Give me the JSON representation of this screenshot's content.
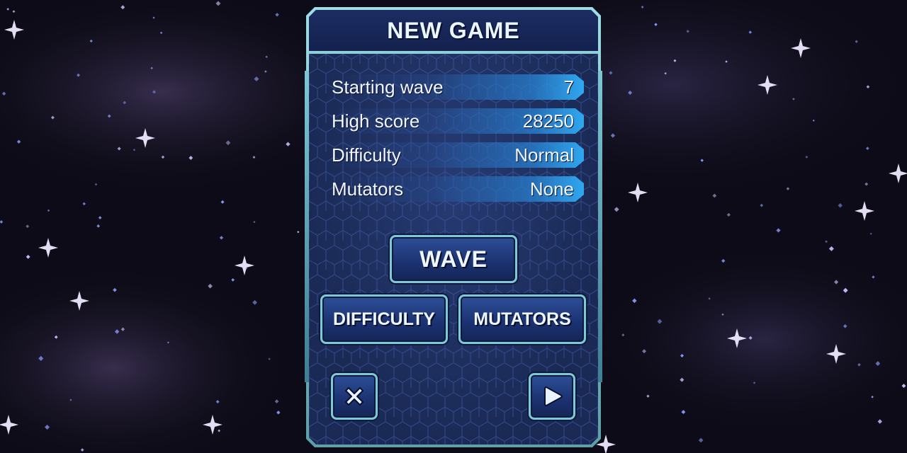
{
  "dialog": {
    "title": "NEW GAME"
  },
  "stats": [
    {
      "label": "Starting wave",
      "value": "7"
    },
    {
      "label": "High score",
      "value": "28250"
    },
    {
      "label": "Difficulty",
      "value": "Normal"
    },
    {
      "label": "Mutators",
      "value": "None"
    }
  ],
  "buttons": {
    "wave": "WAVE",
    "difficulty": "DIFFICULTY",
    "mutators": "MUTATORS",
    "close_icon": "close-icon",
    "play_icon": "play-icon"
  },
  "colors": {
    "panel_border": "#8fcfd8",
    "panel_bg": "#1b2a55",
    "stat_accent": "#2fa7f0",
    "text": "#f2f7ff"
  }
}
